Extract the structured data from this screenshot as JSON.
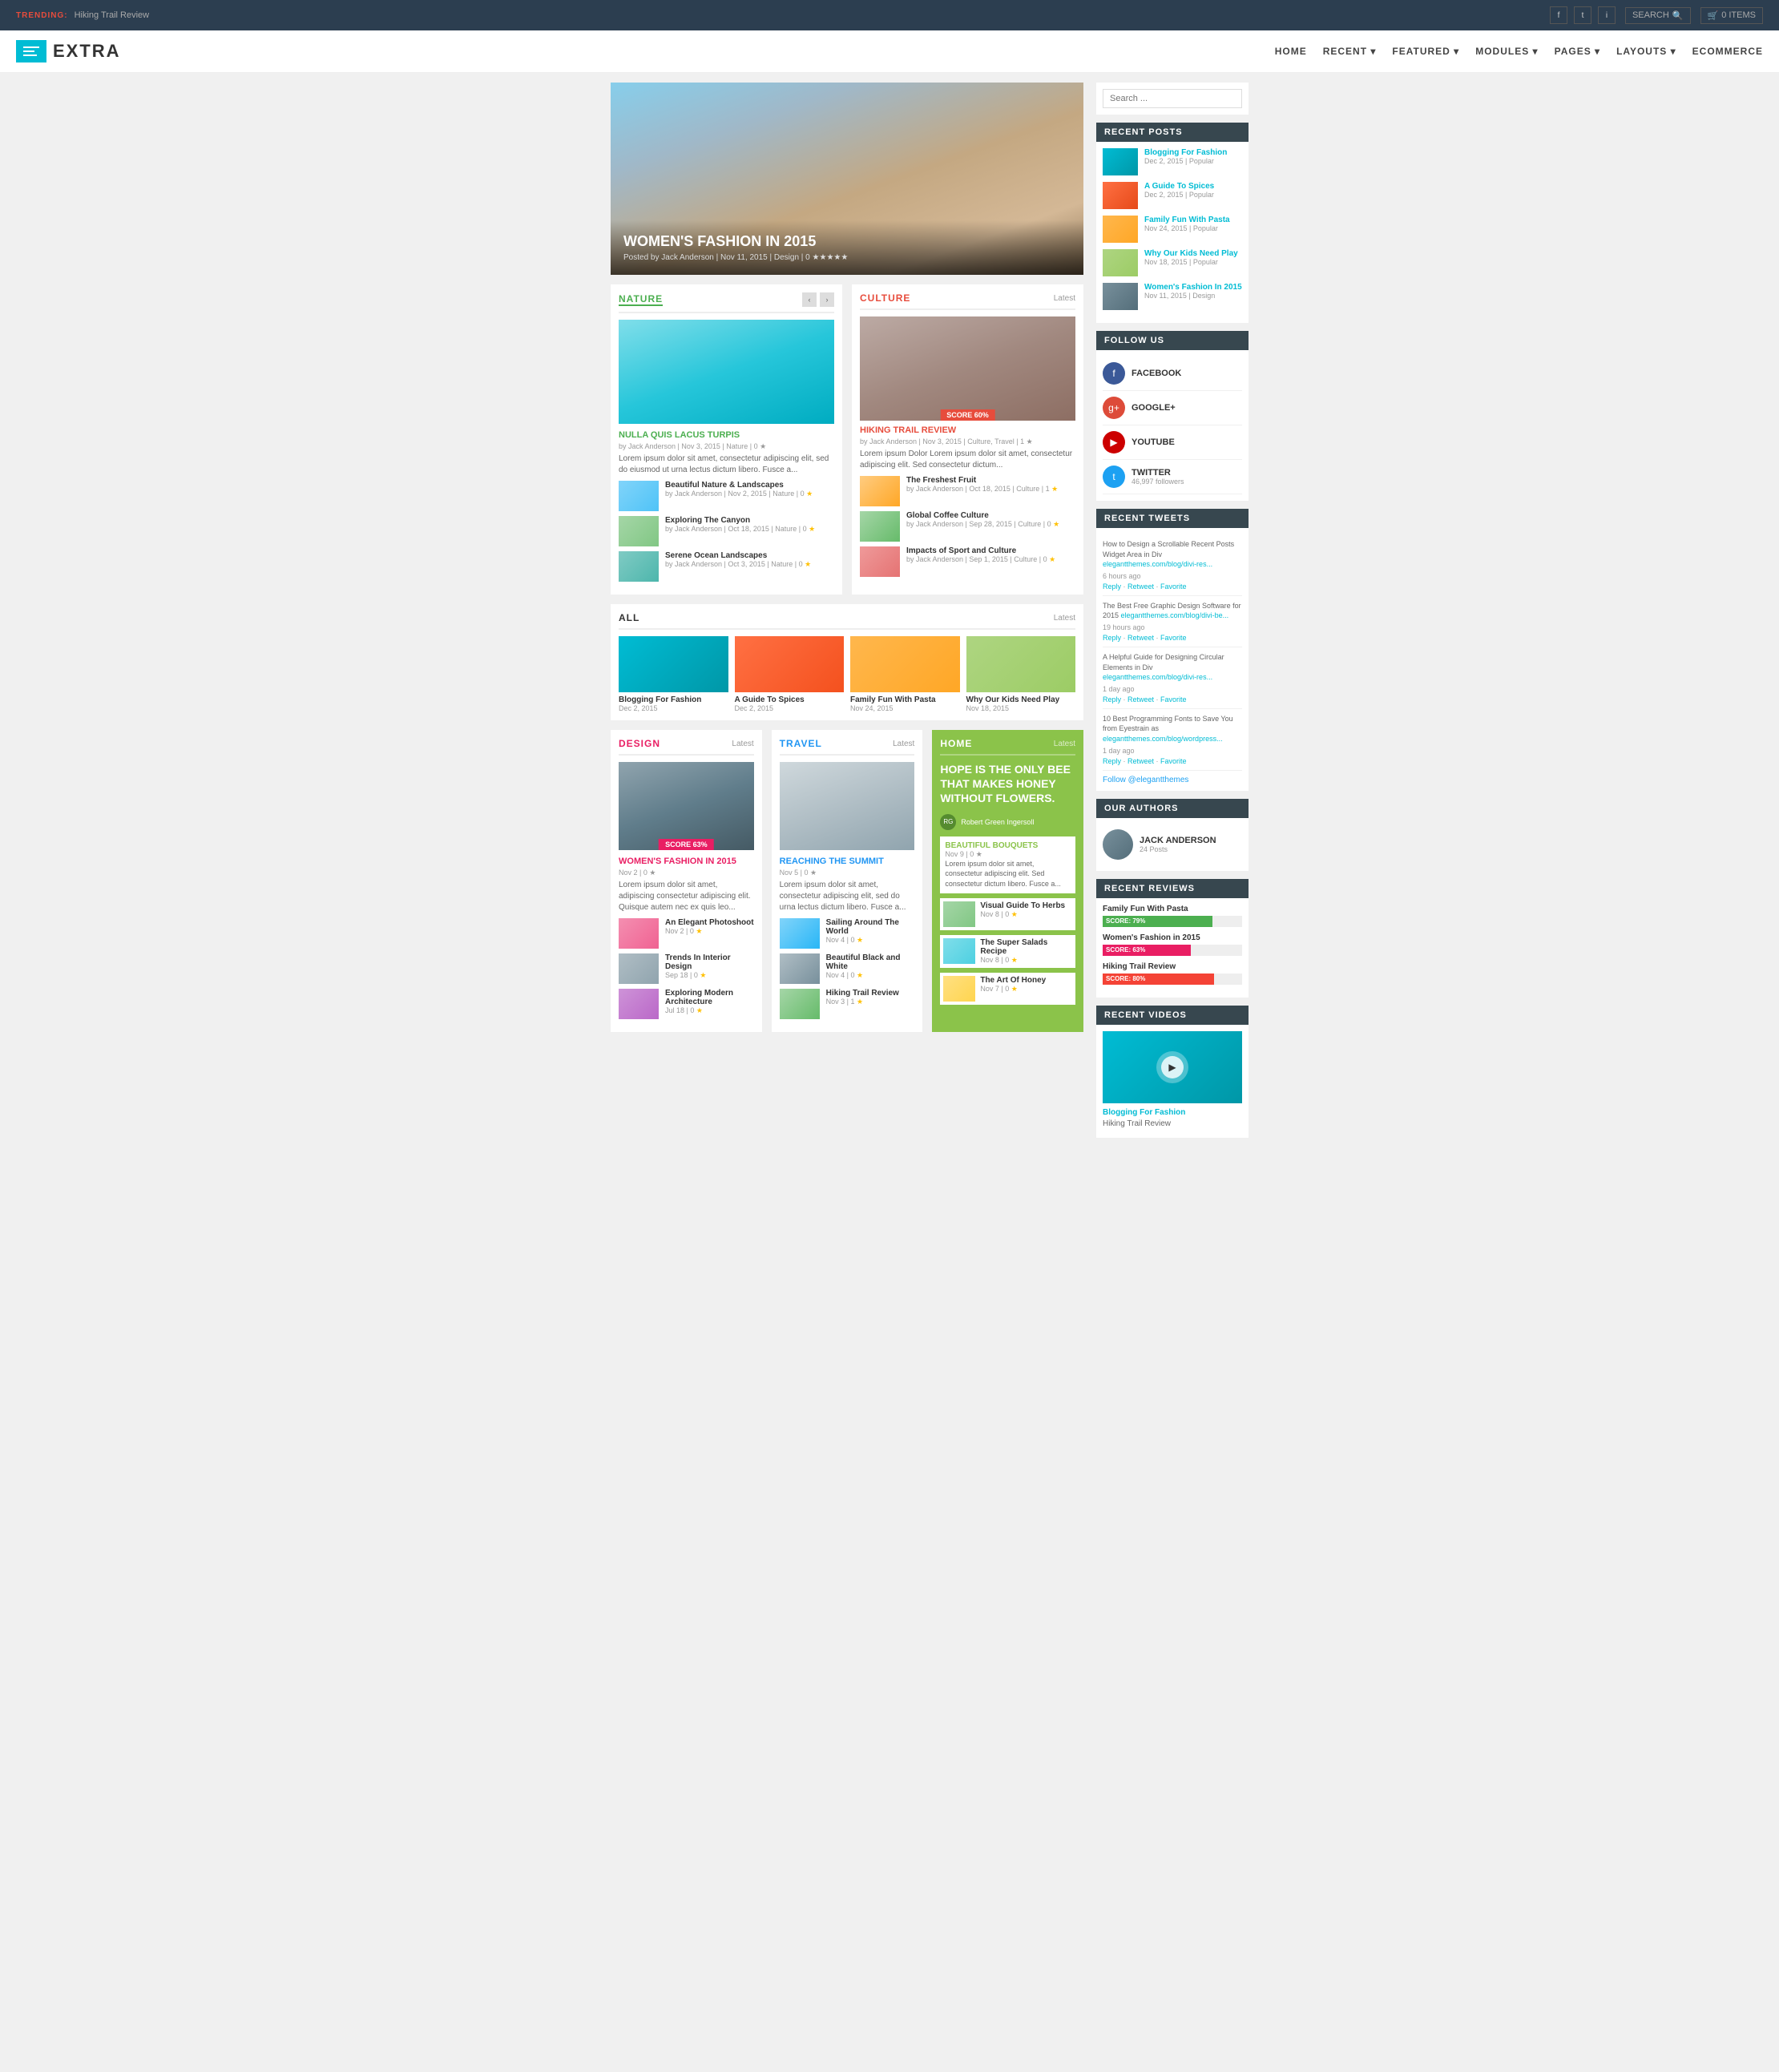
{
  "topbar": {
    "trending_label": "TRENDING:",
    "trending_text": "Hiking Trail Review",
    "search_label": "SEARCH",
    "cart_label": "0 ITEMS"
  },
  "header": {
    "logo_text": "EXTRA",
    "nav_items": [
      "HOME",
      "RECENT",
      "FEATURED",
      "MODULES",
      "PAGES",
      "LAYOUTS",
      "ECOMMERCE"
    ]
  },
  "hero": {
    "title": "WOMEN'S FASHION IN 2015",
    "meta": "Posted by Jack Anderson | Nov 11, 2015 | Design | 0 ★★★★★"
  },
  "nature": {
    "section_title": "NATURE",
    "main_article": {
      "title": "NULLA QUIS LACUS TURPIS",
      "meta": "by Jack Anderson | Nov 3, 2015 | Nature | 0 ★",
      "text": "Lorem ipsum dolor sit amet, consectetur adipiscing elit, sed do eiusmod ut urna lectus dictum libero. Fusce a..."
    },
    "sub_articles": [
      {
        "title": "Beautiful Nature & Landscapes",
        "meta": "by Jack Anderson | Nov 2, 2015 | Nature | 0 ★"
      },
      {
        "title": "Exploring The Canyon",
        "meta": "by Jack Anderson | Oct 18, 2015 | Nature | 0 ★"
      },
      {
        "title": "Serene Ocean Landscapes",
        "meta": "by Jack Anderson | Oct 3, 2015 | Nature | 0 ★"
      }
    ]
  },
  "culture": {
    "section_title": "CULTURE",
    "latest": "Latest",
    "score": "SCORE 60%",
    "main_article": {
      "title": "HIKING TRAIL REVIEW",
      "meta": "by Jack Anderson | Nov 3, 2015 | Culture, Travel | 1 ★",
      "text": "Lorem ipsum Dolor Lorem ipsum dolor sit amet, consectetur adipiscing elit. Sed consectetur dictum..."
    },
    "sub_articles": [
      {
        "title": "The Freshest Fruit",
        "meta": "by Jack Anderson | Oct 18, 2015 | Culture | 1 ★"
      },
      {
        "title": "Global Coffee Culture",
        "meta": "by Jack Anderson | Sep 28, 2015 | Culture | 0 ★"
      },
      {
        "title": "Impacts of Sport and Culture",
        "meta": "by Jack Anderson | Sep 1, 2015 | Culture | 0 ★"
      }
    ]
  },
  "all_section": {
    "section_title": "ALL",
    "latest": "Latest",
    "cards": [
      {
        "title": "Blogging For Fashion",
        "date": "Dec 2, 2015"
      },
      {
        "title": "A Guide To Spices",
        "date": "Dec 2, 2015"
      },
      {
        "title": "Family Fun With Pasta",
        "date": "Nov 24, 2015"
      },
      {
        "title": "Why Our Kids Need Play",
        "date": "Nov 18, 2015"
      }
    ]
  },
  "design": {
    "section_title": "DESIGN",
    "latest": "Latest",
    "score": "SCORE 63%",
    "main_article": {
      "title": "WOMEN'S FASHION IN 2015",
      "meta": "Nov 2 | 0 ★",
      "text": "Lorem ipsum dolor sit amet, adipiscing consectetur adipiscing elit. Quisque autem nec ex quis leo..."
    },
    "sub_articles": [
      {
        "title": "An Elegant Photoshoot",
        "meta": "Nov 2 | 0 ★"
      },
      {
        "title": "Trends In Interior Design",
        "meta": "Sep 18 | 0 ★"
      },
      {
        "title": "Exploring Modern Architecture",
        "meta": "Jul 18 | 0 ★"
      }
    ]
  },
  "travel": {
    "section_title": "TRAVEL",
    "latest": "Latest",
    "main_article": {
      "title": "REACHING THE SUMMIT",
      "meta": "Nov 5 | 0 ★",
      "text": "Lorem ipsum dolor sit amet, consectetur adipiscing elit, sed do urna lectus dictum libero. Fusce a..."
    },
    "sub_articles": [
      {
        "title": "Sailing Around The World",
        "meta": "Nov 4 | 0 ★"
      },
      {
        "title": "Beautiful Black and White",
        "meta": "Nov 4 | 0 ★"
      },
      {
        "title": "Hiking Trail Review",
        "meta": "Nov 3 | 1 ★"
      }
    ]
  },
  "home": {
    "section_title": "HOME",
    "latest": "Latest",
    "hero_text": "HOPE IS THE ONLY BEE THAT MAKES HONEY WITHOUT FLOWERS.",
    "author": "Robert Green Ingersoll",
    "featured": {
      "title": "BEAUTIFUL BOUQUETS",
      "meta": "Nov 9 | 0 ★",
      "text": "Lorem ipsum dolor sit amet, consectetur adipiscing elit. Sed consectetur dictum libero. Fusce a..."
    },
    "sub_articles": [
      {
        "title": "Visual Guide To Herbs",
        "meta": "Nov 8 | 0 ★"
      },
      {
        "title": "The Super Salads Recipe",
        "meta": "Nov 8 | 0 ★"
      },
      {
        "title": "The Art Of Honey",
        "meta": "Nov 7 | 0 ★"
      }
    ]
  },
  "sidebar": {
    "search_placeholder": "Search ...",
    "recent_posts_title": "RECENT POSTS",
    "recent_posts": [
      {
        "title": "Blogging For Fashion",
        "date": "Dec 2, 2015",
        "badge": "Popular"
      },
      {
        "title": "A Guide To Spices",
        "date": "Dec 2, 2015",
        "badge": "Popular"
      },
      {
        "title": "Family Fun With Pasta",
        "date": "Nov 24, 2015",
        "badge": "Popular"
      },
      {
        "title": "Why Our Kids Need Play",
        "date": "Nov 18, 2015",
        "badge": "Popular"
      },
      {
        "title": "Women's Fashion In 2015",
        "date": "Nov 11, 2015",
        "badge": "Design"
      }
    ],
    "follow_title": "FOLLOW US",
    "follow_items": [
      {
        "name": "FACEBOOK",
        "icon": "f"
      },
      {
        "name": "GOOGLE+",
        "icon": "g"
      },
      {
        "name": "YOUTUBE",
        "icon": "▶"
      },
      {
        "name": "TWITTER",
        "count": "46,997 followers",
        "icon": "t"
      }
    ],
    "tweets_title": "RECENT TWEETS",
    "tweets": [
      {
        "text": "How to Design a Scrollable Recent Posts Widget Area in Div elegantthemes.com/blog/divi-res...",
        "time": "6 hours ago",
        "actions": "Reply · Retweet · Favorite"
      },
      {
        "text": "The Best Free Graphic Design Software for 2015 elegantthemes.com/blog/divi-be...",
        "time": "19 hours ago",
        "actions": "Reply · Retweet · Favorite"
      },
      {
        "text": "A Helpful Guide for Designing Circular Elements in Div elegantthemes.com/blog/divi-res...",
        "time": "1 day ago",
        "actions": "Reply · Retweet · Favorite"
      },
      {
        "text": "10 Best Programming Fonts to Save You from Eyestrain as elegantthemes.com/blog/wordpress...",
        "time": "1 day ago",
        "actions": "Reply · Retweet · Favorite"
      }
    ],
    "follow_link": "Follow @elegantthemes",
    "authors_title": "OUR AUTHORS",
    "author_name": "JACK ANDERSON",
    "author_posts": "24 Posts",
    "reviews_title": "RECENT REVIEWS",
    "reviews": [
      {
        "title": "Family Fun With Pasta",
        "score": "SCORE: 79%",
        "pct": 79,
        "color": "green"
      },
      {
        "title": "Women's Fashion in 2015",
        "score": "SCORE: 63%",
        "pct": 63,
        "color": "pink"
      },
      {
        "title": "Hiking Trail Review",
        "score": "SCORE: 80%",
        "pct": 80,
        "color": "red"
      }
    ],
    "videos_title": "RECENT VIDEOS",
    "video_items": [
      {
        "title": "Blogging For Fashion"
      },
      {
        "title": "Hiking Trail Review"
      }
    ]
  }
}
